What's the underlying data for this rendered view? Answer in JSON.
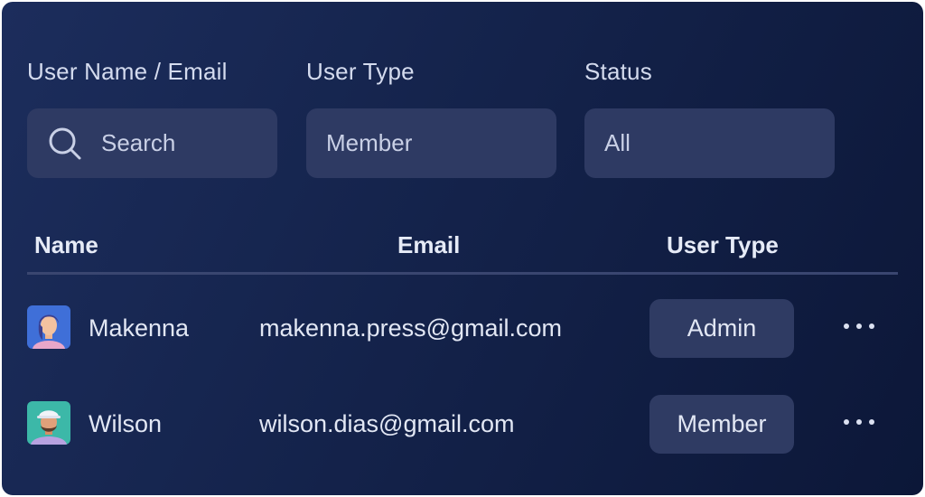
{
  "filters": {
    "user_name_email": {
      "label": "User Name / Email",
      "placeholder": "Search",
      "icon": "search-icon"
    },
    "user_type": {
      "label": "User Type",
      "value": "Member"
    },
    "status": {
      "label": "Status",
      "value": "All"
    }
  },
  "table": {
    "columns": [
      "Name",
      "Email",
      "User Type"
    ],
    "rows": [
      {
        "name": "Makenna",
        "email": "makenna.press@gmail.com",
        "user_type": "Admin",
        "avatar": "avatar-makenna"
      },
      {
        "name": "Wilson",
        "email": "wilson.dias@gmail.com",
        "user_type": "Member",
        "avatar": "avatar-wilson"
      }
    ],
    "row_action_icon": "more-horizontal-icon"
  },
  "colors": {
    "background_start": "#1c2d5c",
    "background_end": "#0c1738",
    "field_bg": "#2e3a63",
    "text": "#e2e7f4"
  }
}
